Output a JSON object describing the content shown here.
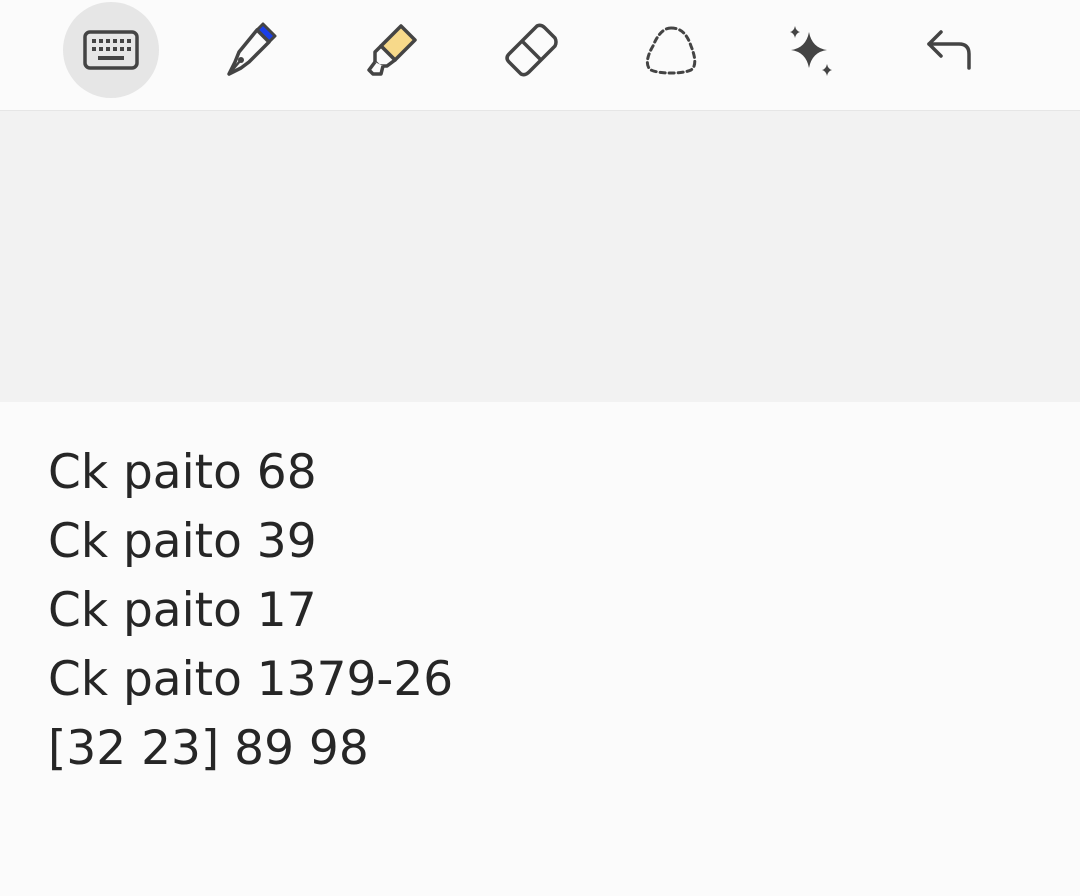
{
  "toolbar": {
    "tools": [
      {
        "icon": "keyboard-icon",
        "active": true
      },
      {
        "icon": "pen-icon",
        "color": "#1a3ee8",
        "active": false
      },
      {
        "icon": "highlighter-icon",
        "color": "#f7d98a",
        "active": false
      },
      {
        "icon": "eraser-icon",
        "active": false
      },
      {
        "icon": "lasso-select-icon",
        "active": false
      },
      {
        "icon": "sparkle-icon",
        "active": false
      },
      {
        "icon": "undo-icon",
        "active": false
      }
    ]
  },
  "note": {
    "lines": [
      "Ck paito 68",
      "Ck paito 39",
      "Ck paito 17",
      "Ck paito 1379-26",
      "[32 23] 89 98"
    ]
  }
}
